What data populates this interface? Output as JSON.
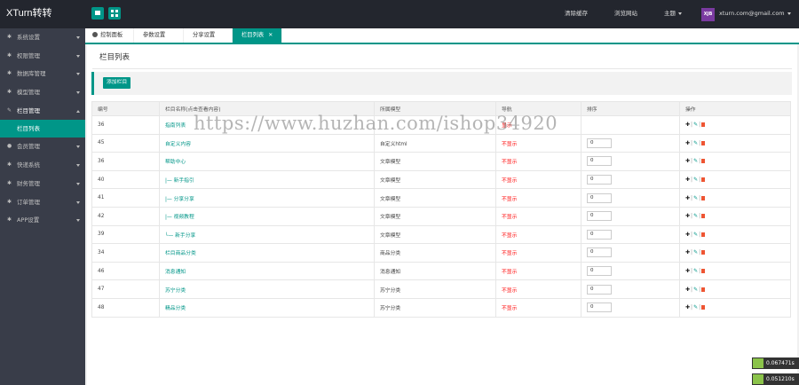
{
  "brand": "XTurn转转",
  "topbar": {
    "clear_cache": "清除缓存",
    "browse_site": "浏览网站",
    "theme": "主题",
    "avatar_text": "XJB",
    "user_email": "xturn.com@gmail.com"
  },
  "sidebar": {
    "items": [
      {
        "label": "系统设置",
        "icon": "wrench-icon",
        "open": false
      },
      {
        "label": "权限管理",
        "icon": "wrench-icon",
        "open": false
      },
      {
        "label": "数据库管理",
        "icon": "wrench-icon",
        "open": false
      },
      {
        "label": "模型管理",
        "icon": "wrench-icon",
        "open": false
      },
      {
        "label": "栏目管理",
        "icon": "edit-icon",
        "open": true,
        "sub": [
          "栏目列表"
        ]
      },
      {
        "label": "会员管理",
        "icon": "user-icon",
        "open": false
      },
      {
        "label": "快递系统",
        "icon": "wrench-icon",
        "open": false
      },
      {
        "label": "财务管理",
        "icon": "wrench-icon",
        "open": false
      },
      {
        "label": "订单管理",
        "icon": "wrench-icon",
        "open": false
      },
      {
        "label": "APP设置",
        "icon": "wrench-icon",
        "open": false
      }
    ]
  },
  "tabs": [
    {
      "label": "控制面板",
      "active": false
    },
    {
      "label": "参数设置",
      "active": false
    },
    {
      "label": "分享设置",
      "active": false
    },
    {
      "label": "栏目列表",
      "active": true
    }
  ],
  "page": {
    "title": "栏目列表",
    "add_button": "添加栏目"
  },
  "table": {
    "headers": [
      "编号",
      "栏目名称(点击查看内容)",
      "所属模型",
      "导航",
      "排序",
      "操作"
    ],
    "rows": [
      {
        "id": "36",
        "name": "指南列表",
        "model": "",
        "nav": "显示",
        "order": ""
      },
      {
        "id": "45",
        "name": "自定义内容",
        "model": "自定义html",
        "nav": "不显示",
        "order": "0"
      },
      {
        "id": "36",
        "name": "帮助中心",
        "model": "文章模型",
        "nav": "不显示",
        "order": "0"
      },
      {
        "id": "40",
        "name": "|— 新手指引",
        "model": "文章模型",
        "nav": "不显示",
        "order": "0"
      },
      {
        "id": "41",
        "name": "|— 分享分享",
        "model": "文章模型",
        "nav": "不显示",
        "order": "0"
      },
      {
        "id": "42",
        "name": "|— 视频教程",
        "model": "文章模型",
        "nav": "不显示",
        "order": "0"
      },
      {
        "id": "39",
        "name": "└— 新手分享",
        "model": "文章模型",
        "nav": "不显示",
        "order": "0"
      },
      {
        "id": "34",
        "name": "栏目商品分类",
        "model": "商品分类",
        "nav": "不显示",
        "order": "0"
      },
      {
        "id": "46",
        "name": "消息通知",
        "model": "消息通知",
        "nav": "不显示",
        "order": "0"
      },
      {
        "id": "47",
        "name": "苏宁分类",
        "model": "苏宁分类",
        "nav": "不显示",
        "order": "0"
      },
      {
        "id": "48",
        "name": "精品分类",
        "model": "苏宁分类",
        "nav": "不显示",
        "order": "0"
      }
    ]
  },
  "watermark": "https://www.huzhan.com/ishop34920",
  "timers": [
    "0.067471s",
    "0.051210s"
  ]
}
